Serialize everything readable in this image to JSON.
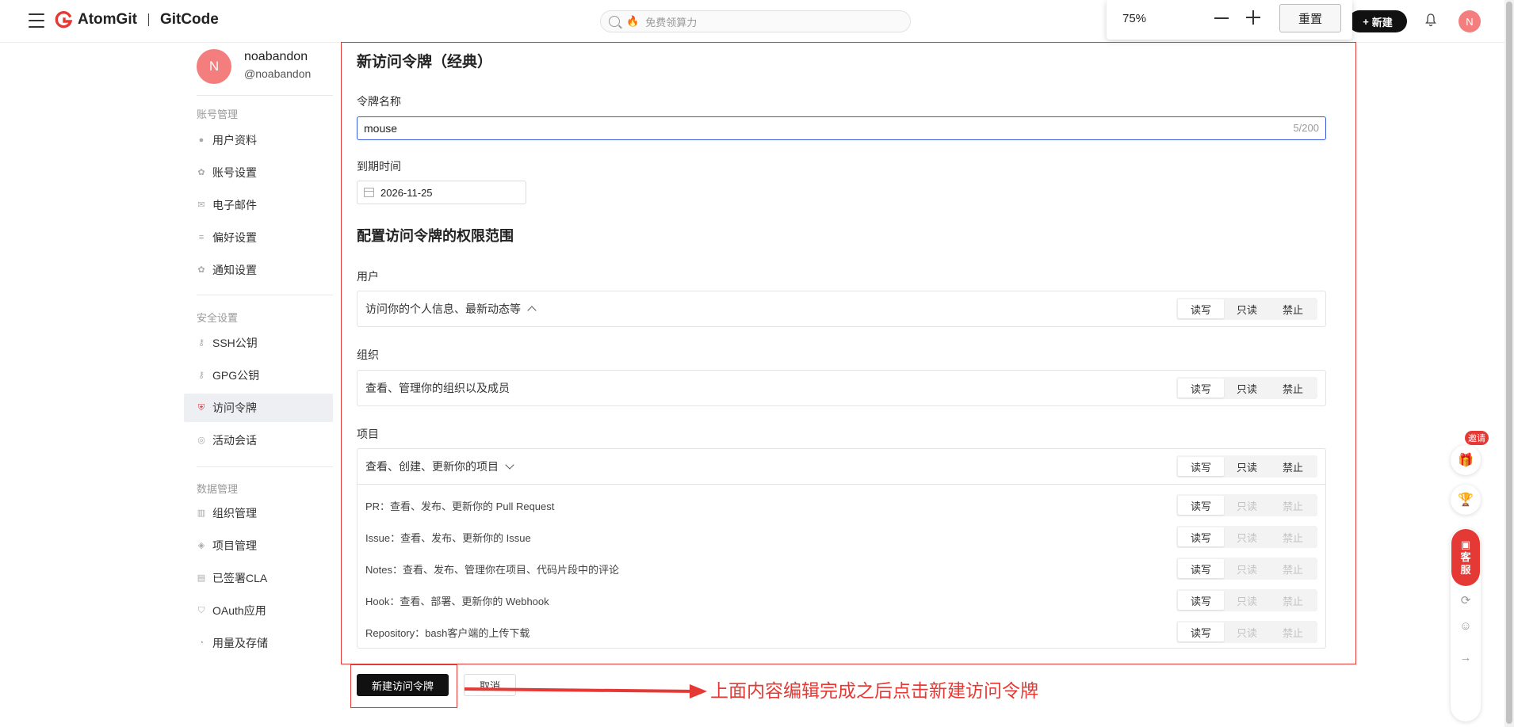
{
  "header": {
    "brand_name": "AtomGit",
    "product_name": "GitCode",
    "search_placeholder": "免费领算力",
    "new_label": "新建",
    "avatar_letter": "N"
  },
  "zoom": {
    "value": "75%",
    "reset_label": "重置"
  },
  "sidebar": {
    "avatar_letter": "N",
    "name": "noabandon",
    "handle": "@noabandon",
    "sections": {
      "account": "账号管理",
      "security": "安全设置",
      "data": "数据管理"
    },
    "items": [
      {
        "label": "用户资料",
        "icon": "user-icon"
      },
      {
        "label": "账号设置",
        "icon": "gear-icon"
      },
      {
        "label": "电子邮件",
        "icon": "mail-icon"
      },
      {
        "label": "偏好设置",
        "icon": "sliders-icon"
      },
      {
        "label": "通知设置",
        "icon": "notification-gear-icon"
      },
      {
        "label": "SSH公钥",
        "icon": "key-icon"
      },
      {
        "label": "GPG公钥",
        "icon": "key-icon"
      },
      {
        "label": "访问令牌",
        "icon": "shield-icon"
      },
      {
        "label": "活动会话",
        "icon": "broadcast-icon"
      },
      {
        "label": "组织管理",
        "icon": "building-icon"
      },
      {
        "label": "项目管理",
        "icon": "layers-icon"
      },
      {
        "label": "已签署CLA",
        "icon": "document-icon"
      },
      {
        "label": "OAuth应用",
        "icon": "shield-check-icon"
      },
      {
        "label": "用量及存储",
        "icon": "pie-icon"
      }
    ]
  },
  "form": {
    "title": "新访问令牌（经典）",
    "name_label": "令牌名称",
    "name_value": "mouse",
    "name_count": "5/200",
    "expire_label": "到期时间",
    "expire_value": "2026-11-25",
    "scope_title": "配置访问令牌的权限范围",
    "option_labels": {
      "rw": "读写",
      "ro": "只读",
      "deny": "禁止"
    },
    "groups": [
      {
        "label": "用户",
        "summary": "访问你的个人信息、最新动态等",
        "selected": "读写"
      },
      {
        "label": "组织",
        "summary": "查看、管理你的组织以及成员",
        "selected": "读写"
      },
      {
        "label": "项目",
        "summary": "查看、创建、更新你的项目",
        "selected": "读写",
        "sub": [
          "PR：查看、发布、更新你的 Pull Request",
          "Issue：查看、发布、更新你的 Issue",
          "Notes：查看、发布、管理你在项目、代码片段中的评论",
          "Hook：查看、部署、更新你的 Webhook",
          "Repository：bash客户端的上传下载"
        ]
      }
    ],
    "submit_label": "新建访问令牌",
    "cancel_label": "取消"
  },
  "annotation": "上面内容编辑完成之后点击新建访问令牌",
  "floating": {
    "invite_label": "邀请",
    "support_label_1": "客",
    "support_label_2": "服"
  },
  "colors": {
    "accent_red": "#e53935",
    "input_focus_blue": "#3b5bdb",
    "avatar_pink": "#f47e7e"
  }
}
